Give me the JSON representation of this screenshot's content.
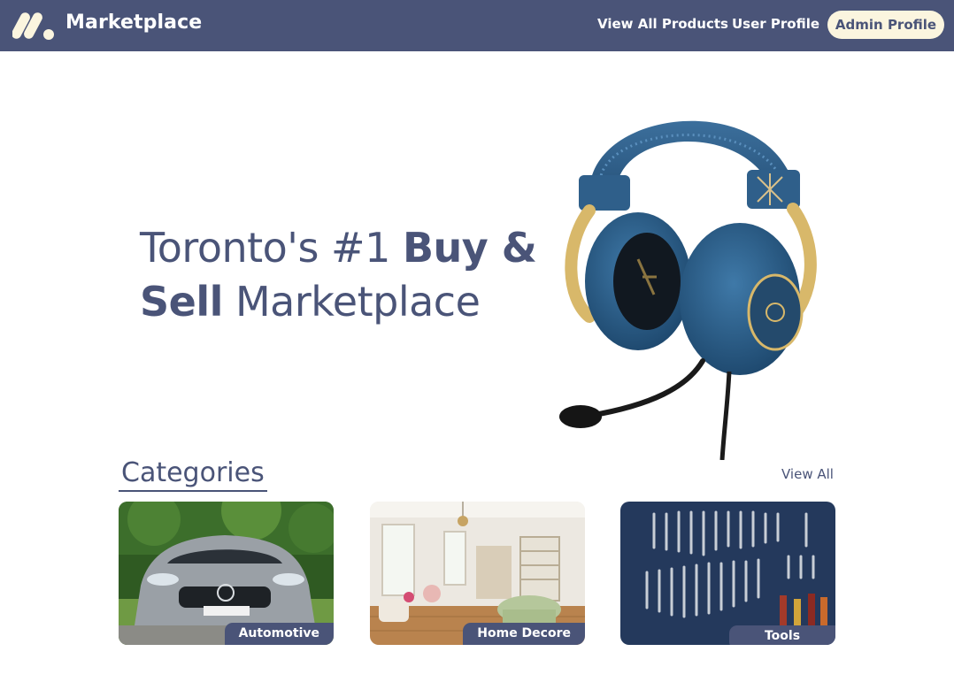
{
  "header": {
    "brand": "Marketplace",
    "logo_icon": "marketplace-logo-icon",
    "nav": {
      "products": "View All Products",
      "user": "User Profile",
      "admin": "Admin Profile"
    },
    "colors": {
      "bar": "#4a5478",
      "admin_pill": "#fbf5df"
    }
  },
  "hero": {
    "title_part1": "Toronto's #1 ",
    "title_bold1": "Buy &",
    "title_bold2": "Sell",
    "title_part2": " Marketplace",
    "image_icon": "gaming-headset-image"
  },
  "categories": {
    "heading": "Categories",
    "view_all": "View All",
    "items": [
      {
        "label": "Automotive",
        "image": "car-photo"
      },
      {
        "label": "Home Decore",
        "image": "living-room-photo"
      },
      {
        "label": "Tools",
        "image": "wrench-wall-photo"
      }
    ]
  }
}
